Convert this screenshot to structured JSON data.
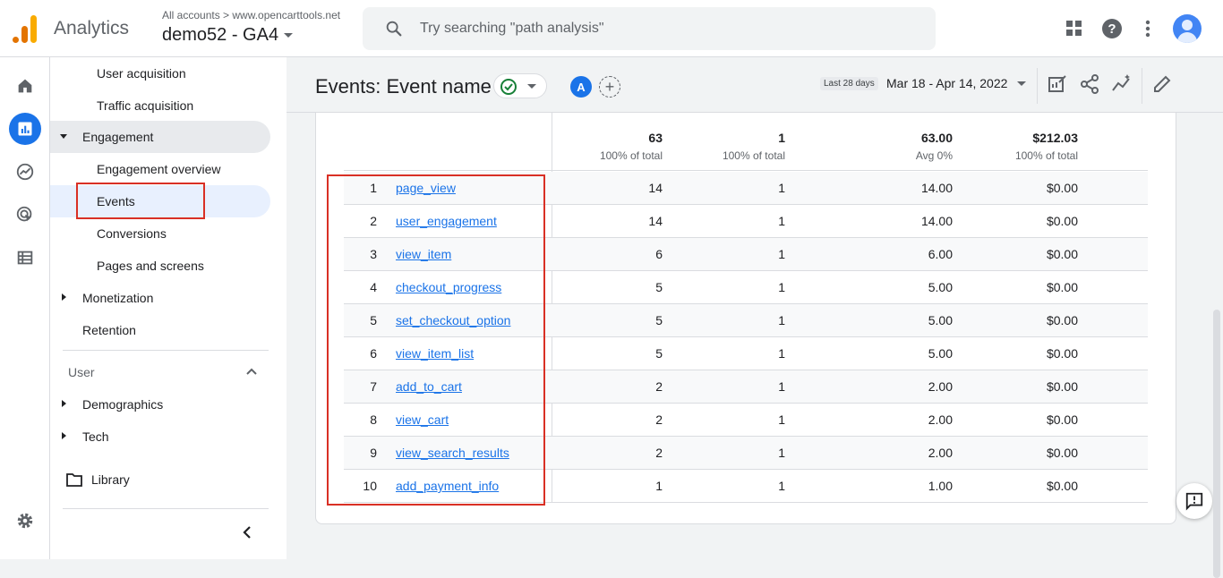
{
  "header": {
    "app_name": "Analytics",
    "breadcrumb": "All accounts > www.opencarttools.net",
    "property": "demo52 - GA4",
    "search_placeholder": "Try searching \"path analysis\""
  },
  "sidenav": {
    "items": [
      {
        "label": "User acquisition"
      },
      {
        "label": "Traffic acquisition"
      },
      {
        "label": "Engagement"
      },
      {
        "label": "Engagement overview"
      },
      {
        "label": "Events"
      },
      {
        "label": "Conversions"
      },
      {
        "label": "Pages and screens"
      },
      {
        "label": "Monetization"
      },
      {
        "label": "Retention"
      }
    ],
    "user_section": "User",
    "user_items": [
      {
        "label": "Demographics"
      },
      {
        "label": "Tech"
      }
    ],
    "library": "Library"
  },
  "report": {
    "title": "Events: Event name",
    "compare_badge": "A",
    "date_tag": "Last 28 days",
    "date_range": "Mar 18 - Apr 14, 2022",
    "totals": [
      {
        "value": "63",
        "sub": "100% of total"
      },
      {
        "value": "1",
        "sub": "100% of total"
      },
      {
        "value": "63.00",
        "sub": "Avg 0%"
      },
      {
        "value": "$212.03",
        "sub": "100% of total"
      }
    ],
    "rows": [
      {
        "rank": "1",
        "event": "page_view",
        "c1": "14",
        "c2": "1",
        "c3": "14.00",
        "c4": "$0.00"
      },
      {
        "rank": "2",
        "event": "user_engagement",
        "c1": "14",
        "c2": "1",
        "c3": "14.00",
        "c4": "$0.00"
      },
      {
        "rank": "3",
        "event": "view_item",
        "c1": "6",
        "c2": "1",
        "c3": "6.00",
        "c4": "$0.00"
      },
      {
        "rank": "4",
        "event": "checkout_progress",
        "c1": "5",
        "c2": "1",
        "c3": "5.00",
        "c4": "$0.00"
      },
      {
        "rank": "5",
        "event": "set_checkout_option",
        "c1": "5",
        "c2": "1",
        "c3": "5.00",
        "c4": "$0.00"
      },
      {
        "rank": "6",
        "event": "view_item_list",
        "c1": "5",
        "c2": "1",
        "c3": "5.00",
        "c4": "$0.00"
      },
      {
        "rank": "7",
        "event": "add_to_cart",
        "c1": "2",
        "c2": "1",
        "c3": "2.00",
        "c4": "$0.00"
      },
      {
        "rank": "8",
        "event": "view_cart",
        "c1": "2",
        "c2": "1",
        "c3": "2.00",
        "c4": "$0.00"
      },
      {
        "rank": "9",
        "event": "view_search_results",
        "c1": "2",
        "c2": "1",
        "c3": "2.00",
        "c4": "$0.00"
      },
      {
        "rank": "10",
        "event": "add_payment_info",
        "c1": "1",
        "c2": "1",
        "c3": "1.00",
        "c4": "$0.00"
      }
    ]
  },
  "colors": {
    "accent": "#1a73e8",
    "highlight_border": "#d93025",
    "logo_orange": "#e37400",
    "logo_yellow": "#f9ab00"
  },
  "icons": [
    "search-icon",
    "apps-grid-icon",
    "help-icon",
    "more-vert-icon",
    "home-icon",
    "reports-icon",
    "explore-icon",
    "advertising-icon",
    "configure-icon",
    "settings-gear-icon",
    "folder-icon",
    "collapse-chevron-icon",
    "check-circle-icon",
    "edit-report-icon",
    "share-icon",
    "insights-icon",
    "pencil-icon",
    "feedback-icon"
  ]
}
